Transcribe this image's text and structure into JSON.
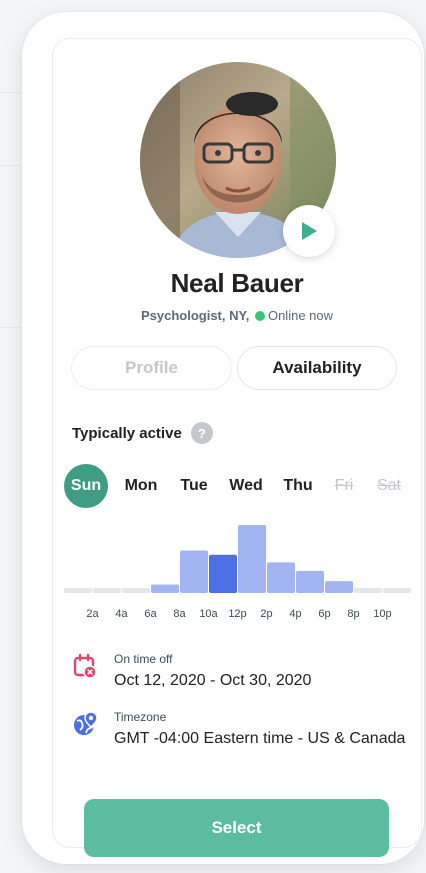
{
  "profile": {
    "name": "Neal Bauer",
    "role": "Psychologist, NY,",
    "status": "Online now",
    "status_color": "#3dc27a",
    "avatar_icon": "person-photo",
    "play_icon": "play-icon"
  },
  "tabs": [
    {
      "label": "Profile",
      "active": false
    },
    {
      "label": "Availability",
      "active": true
    }
  ],
  "activity": {
    "title": "Typically active",
    "help_glyph": "?",
    "days": [
      {
        "label": "Sun",
        "state": "selected"
      },
      {
        "label": "Mon",
        "state": "available"
      },
      {
        "label": "Tue",
        "state": "available"
      },
      {
        "label": "Wed",
        "state": "available"
      },
      {
        "label": "Thu",
        "state": "available"
      },
      {
        "label": "Fri",
        "state": "unavailable"
      },
      {
        "label": "Sat",
        "state": "unavailable"
      }
    ]
  },
  "chart_data": {
    "type": "bar",
    "categories": [
      "2a",
      "4a",
      "6a",
      "8a",
      "10a",
      "12p",
      "2p",
      "4p",
      "6p",
      "8p",
      "10p"
    ],
    "values": [
      0,
      0,
      0,
      1,
      5,
      4.5,
      8,
      3.6,
      2.6,
      1.4,
      0,
      0
    ],
    "bar_slots": [
      "12a",
      "2a",
      "4a",
      "6a",
      "8a",
      "10a",
      "12p",
      "2p",
      "4p",
      "6p",
      "8p",
      "10p"
    ],
    "highlighted_slot": "10a",
    "colors": {
      "bar": "#a3b4f3",
      "highlight": "#4e6ee6",
      "empty": "#e3e6ea"
    },
    "title": "",
    "xlabel": "",
    "ylabel": ""
  },
  "time_off": {
    "icon": "calendar-cancel-icon",
    "label": "On time off",
    "value": "Oct 12, 2020 - Oct 30, 2020",
    "icon_color": "#e2476b"
  },
  "timezone": {
    "icon": "globe-pin-icon",
    "label": "Timezone",
    "value": "GMT -04:00 Eastern time - US & Canada",
    "icon_color": "#4e6ee6"
  },
  "actions": {
    "select_label": "Select",
    "select_color": "#5bbd9e"
  }
}
